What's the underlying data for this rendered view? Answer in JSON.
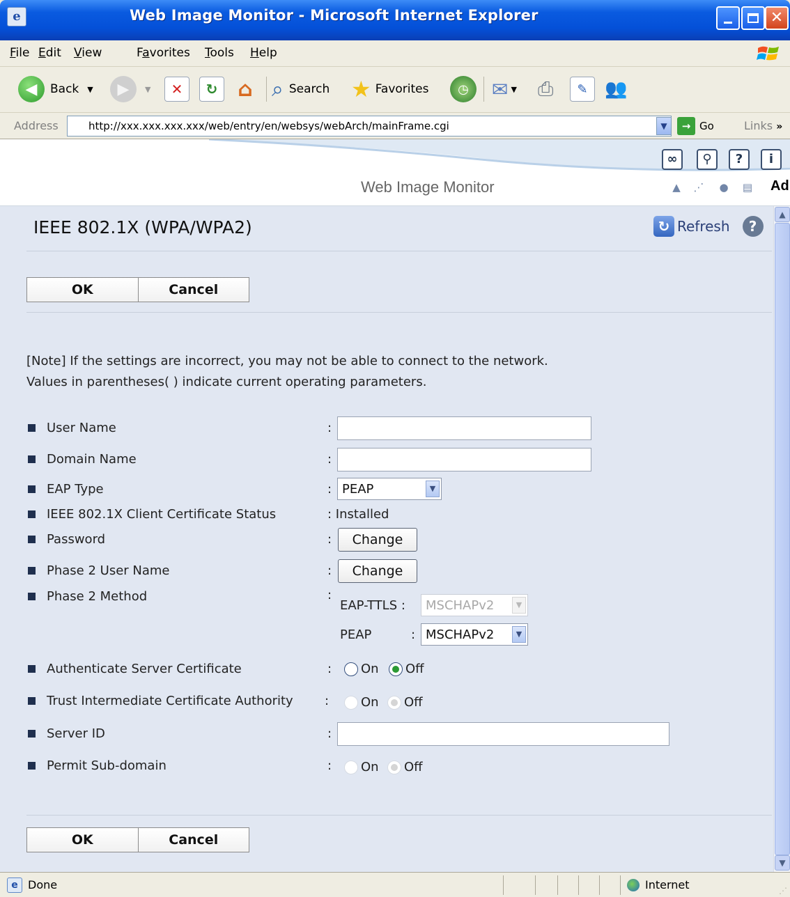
{
  "window": {
    "title": "Web Image Monitor - Microsoft Internet Explorer"
  },
  "menu": [
    {
      "pre": "",
      "ul": "F",
      "post": "ile"
    },
    {
      "pre": "",
      "ul": "E",
      "post": "dit"
    },
    {
      "pre": "",
      "ul": "V",
      "post": "iew"
    },
    {
      "pre": "F",
      "ul": "a",
      "post": "vorites"
    },
    {
      "pre": "",
      "ul": "T",
      "post": "ools"
    },
    {
      "pre": "",
      "ul": "H",
      "post": "elp"
    }
  ],
  "toolbar": {
    "back": "Back",
    "search": "Search",
    "favorites": "Favorites"
  },
  "address": {
    "label": "Address",
    "url": "http://xxx.xxx.xxx.xxx/web/entry/en/websys/webArch/mainFrame.cgi",
    "go": "Go",
    "links": "Links"
  },
  "header": {
    "title": "Web Image Monitor",
    "truncated": "Ad"
  },
  "page": {
    "title": "IEEE 802.1X (WPA/WPA2)",
    "refresh": "Refresh",
    "ok": "OK",
    "cancel": "Cancel",
    "note1": "[Note] If the settings are incorrect, you may not be able to connect to the network.",
    "note2": "Values in parentheses( ) indicate current operating parameters."
  },
  "form": {
    "user_name": {
      "label": "User Name",
      "value": ""
    },
    "domain_name": {
      "label": "Domain Name",
      "value": ""
    },
    "eap_type": {
      "label": "EAP Type",
      "value": "PEAP"
    },
    "cert_status": {
      "label": "IEEE 802.1X Client Certificate Status",
      "value": ": Installed"
    },
    "password": {
      "label": "Password",
      "button": "Change"
    },
    "phase2_user": {
      "label": "Phase 2 User Name",
      "button": "Change"
    },
    "phase2_method": {
      "label": "Phase 2 Method",
      "ttls_label": "EAP-TTLS :",
      "ttls_value": "MSCHAPv2",
      "peap_label": "PEAP",
      "peap_value": "MSCHAPv2"
    },
    "auth_server": {
      "label": "Authenticate Server Certificate",
      "on": "On",
      "off": "Off",
      "selected": "Off"
    },
    "trust_ca": {
      "label": "Trust Intermediate Certificate Authority",
      "on": "On",
      "off": "Off",
      "selected": "Off"
    },
    "server_id": {
      "label": "Server ID",
      "value": ""
    },
    "sub_domain": {
      "label": "Permit Sub-domain",
      "on": "On",
      "off": "Off",
      "selected": "Off"
    }
  },
  "status": {
    "text": "Done",
    "zone": "Internet"
  }
}
